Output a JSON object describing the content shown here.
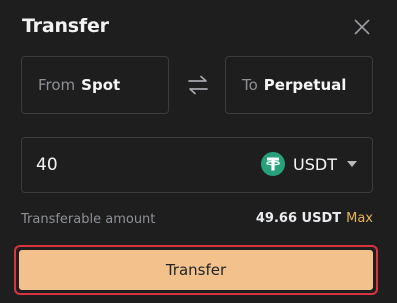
{
  "dialog": {
    "title": "Transfer"
  },
  "from": {
    "prefix": "From",
    "account": "Spot"
  },
  "to": {
    "prefix": "To",
    "account": "Perpetual"
  },
  "amount": {
    "value": "40",
    "coin": "USDT"
  },
  "transferable": {
    "label": "Transferable amount",
    "value": "49.66 USDT",
    "max_label": "Max"
  },
  "actions": {
    "submit_label": "Transfer"
  },
  "icons": {
    "close": "close-icon",
    "swap": "swap-arrows-icon",
    "coin": "tether-usdt-icon",
    "caret": "caret-down-icon"
  },
  "colors": {
    "background": "#1e1e1f",
    "accent": "#f3c28c",
    "max": "#e8b25c",
    "highlight_border": "#d9343f",
    "usdt": "#26a17b"
  }
}
